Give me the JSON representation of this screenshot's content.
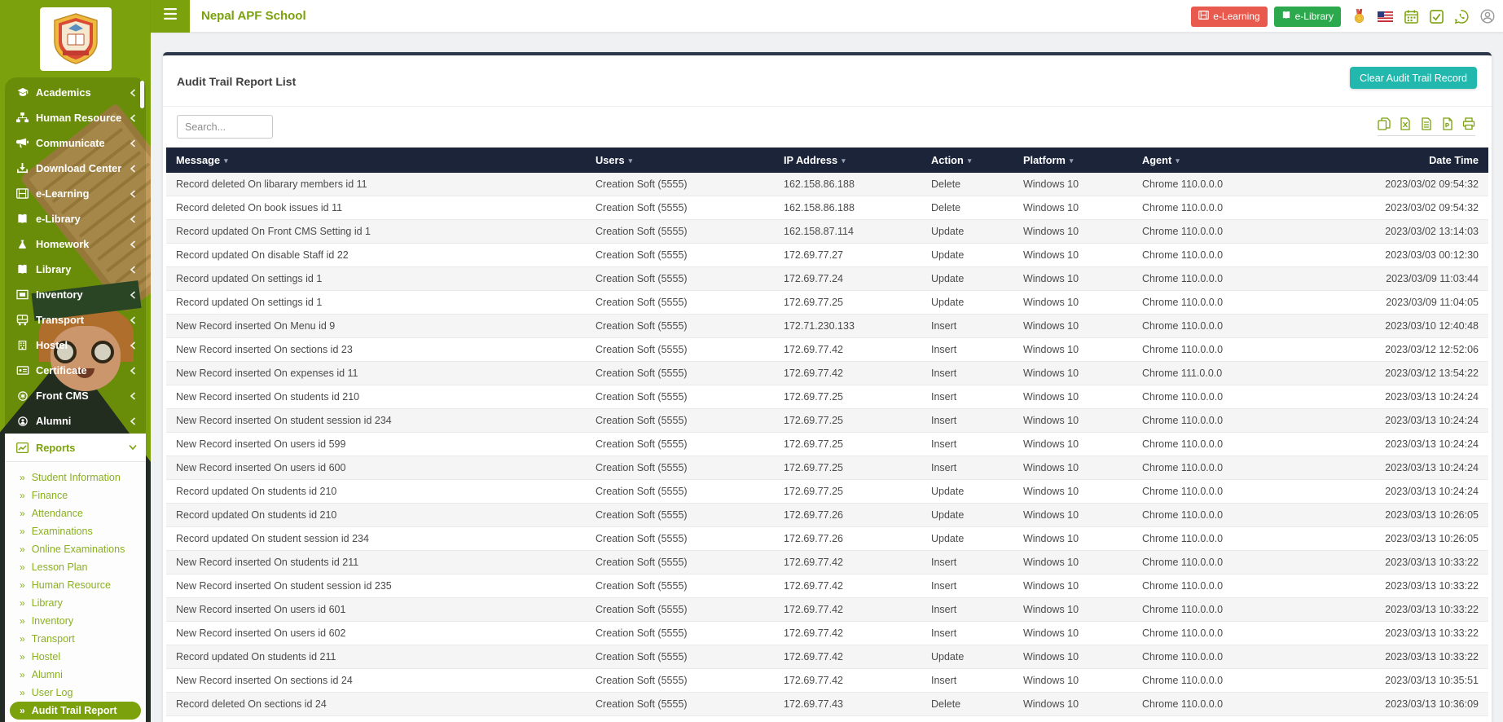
{
  "navbar": {
    "title": "Nepal APF School",
    "elearning_label": "e-Learning",
    "elibrary_label": "e-Library",
    "icons": [
      "medal-icon",
      "us-flag-icon",
      "calendar-icon",
      "approve-leave-icon",
      "whatsapp-icon",
      "profile-icon"
    ]
  },
  "sidebar": {
    "items": [
      {
        "label": "Academics",
        "icon": "graduation-cap-icon"
      },
      {
        "label": "Human Resource",
        "icon": "sitemap-icon"
      },
      {
        "label": "Communicate",
        "icon": "megaphone-icon"
      },
      {
        "label": "Download Center",
        "icon": "download-icon"
      },
      {
        "label": "e-Learning",
        "icon": "film-icon"
      },
      {
        "label": "e-Library",
        "icon": "book-icon"
      },
      {
        "label": "Homework",
        "icon": "flask-icon"
      },
      {
        "label": "Library",
        "icon": "book-icon"
      },
      {
        "label": "Inventory",
        "icon": "inventory-icon"
      },
      {
        "label": "Transport",
        "icon": "bus-icon"
      },
      {
        "label": "Hostel",
        "icon": "building-icon"
      },
      {
        "label": "Certificate",
        "icon": "certificate-icon"
      },
      {
        "label": "Front CMS",
        "icon": "front-cms-icon"
      },
      {
        "label": "Alumni",
        "icon": "alumni-icon"
      }
    ],
    "reports": {
      "label": "Reports",
      "icon": "chart-line-icon"
    },
    "reports_submenu": [
      "Student Information",
      "Finance",
      "Attendance",
      "Examinations",
      "Online Examinations",
      "Lesson Plan",
      "Human Resource",
      "Library",
      "Inventory",
      "Transport",
      "Hostel",
      "Alumni",
      "User Log",
      "Audit Trail Report"
    ],
    "active_item": "Audit Trail Report",
    "submenu_bullet": "»"
  },
  "card": {
    "title": "Audit Trail Report List",
    "clear_button": "Clear Audit Trail Record",
    "search_placeholder": "Search...",
    "export_icons": [
      "copy-icon",
      "excel-icon",
      "csv-icon",
      "pdf-icon",
      "print-icon"
    ]
  },
  "table": {
    "columns": [
      {
        "key": "message",
        "label": "Message",
        "sortable": true
      },
      {
        "key": "users",
        "label": "Users",
        "sortable": true
      },
      {
        "key": "ip",
        "label": "IP Address",
        "sortable": true
      },
      {
        "key": "action",
        "label": "Action",
        "sortable": true
      },
      {
        "key": "platform",
        "label": "Platform",
        "sortable": true
      },
      {
        "key": "agent",
        "label": "Agent",
        "sortable": true
      },
      {
        "key": "datetime",
        "label": "Date Time",
        "sortable": false,
        "align": "right"
      }
    ],
    "sort_glyph": "▾",
    "rows": [
      [
        "Record deleted On libarary members id 11",
        "Creation Soft (5555)",
        "162.158.86.188",
        "Delete",
        "Windows 10",
        "Chrome 110.0.0.0",
        "2023/03/02 09:54:32"
      ],
      [
        "Record deleted On book issues id 11",
        "Creation Soft (5555)",
        "162.158.86.188",
        "Delete",
        "Windows 10",
        "Chrome 110.0.0.0",
        "2023/03/02 09:54:32"
      ],
      [
        "Record updated On Front CMS Setting id 1",
        "Creation Soft (5555)",
        "162.158.87.114",
        "Update",
        "Windows 10",
        "Chrome 110.0.0.0",
        "2023/03/02 13:14:03"
      ],
      [
        "Record updated On disable Staff id 22",
        "Creation Soft (5555)",
        "172.69.77.27",
        "Update",
        "Windows 10",
        "Chrome 110.0.0.0",
        "2023/03/03 00:12:30"
      ],
      [
        "Record updated On settings id 1",
        "Creation Soft (5555)",
        "172.69.77.24",
        "Update",
        "Windows 10",
        "Chrome 110.0.0.0",
        "2023/03/09 11:03:44"
      ],
      [
        "Record updated On settings id 1",
        "Creation Soft (5555)",
        "172.69.77.25",
        "Update",
        "Windows 10",
        "Chrome 110.0.0.0",
        "2023/03/09 11:04:05"
      ],
      [
        "New Record inserted On Menu id 9",
        "Creation Soft (5555)",
        "172.71.230.133",
        "Insert",
        "Windows 10",
        "Chrome 110.0.0.0",
        "2023/03/10 12:40:48"
      ],
      [
        "New Record inserted On sections id 23",
        "Creation Soft (5555)",
        "172.69.77.42",
        "Insert",
        "Windows 10",
        "Chrome 110.0.0.0",
        "2023/03/12 12:52:06"
      ],
      [
        "New Record inserted On expenses id 11",
        "Creation Soft (5555)",
        "172.69.77.42",
        "Insert",
        "Windows 10",
        "Chrome 111.0.0.0",
        "2023/03/12 13:54:22"
      ],
      [
        "New Record inserted On students id 210",
        "Creation Soft (5555)",
        "172.69.77.25",
        "Insert",
        "Windows 10",
        "Chrome 110.0.0.0",
        "2023/03/13 10:24:24"
      ],
      [
        "New Record inserted On student session id 234",
        "Creation Soft (5555)",
        "172.69.77.25",
        "Insert",
        "Windows 10",
        "Chrome 110.0.0.0",
        "2023/03/13 10:24:24"
      ],
      [
        "New Record inserted On users id 599",
        "Creation Soft (5555)",
        "172.69.77.25",
        "Insert",
        "Windows 10",
        "Chrome 110.0.0.0",
        "2023/03/13 10:24:24"
      ],
      [
        "New Record inserted On users id 600",
        "Creation Soft (5555)",
        "172.69.77.25",
        "Insert",
        "Windows 10",
        "Chrome 110.0.0.0",
        "2023/03/13 10:24:24"
      ],
      [
        "Record updated On students id 210",
        "Creation Soft (5555)",
        "172.69.77.25",
        "Update",
        "Windows 10",
        "Chrome 110.0.0.0",
        "2023/03/13 10:24:24"
      ],
      [
        "Record updated On students id 210",
        "Creation Soft (5555)",
        "172.69.77.26",
        "Update",
        "Windows 10",
        "Chrome 110.0.0.0",
        "2023/03/13 10:26:05"
      ],
      [
        "Record updated On student session id 234",
        "Creation Soft (5555)",
        "172.69.77.26",
        "Update",
        "Windows 10",
        "Chrome 110.0.0.0",
        "2023/03/13 10:26:05"
      ],
      [
        "New Record inserted On students id 211",
        "Creation Soft (5555)",
        "172.69.77.42",
        "Insert",
        "Windows 10",
        "Chrome 110.0.0.0",
        "2023/03/13 10:33:22"
      ],
      [
        "New Record inserted On student session id 235",
        "Creation Soft (5555)",
        "172.69.77.42",
        "Insert",
        "Windows 10",
        "Chrome 110.0.0.0",
        "2023/03/13 10:33:22"
      ],
      [
        "New Record inserted On users id 601",
        "Creation Soft (5555)",
        "172.69.77.42",
        "Insert",
        "Windows 10",
        "Chrome 110.0.0.0",
        "2023/03/13 10:33:22"
      ],
      [
        "New Record inserted On users id 602",
        "Creation Soft (5555)",
        "172.69.77.42",
        "Insert",
        "Windows 10",
        "Chrome 110.0.0.0",
        "2023/03/13 10:33:22"
      ],
      [
        "Record updated On students id 211",
        "Creation Soft (5555)",
        "172.69.77.42",
        "Update",
        "Windows 10",
        "Chrome 110.0.0.0",
        "2023/03/13 10:33:22"
      ],
      [
        "New Record inserted On sections id 24",
        "Creation Soft (5555)",
        "172.69.77.42",
        "Insert",
        "Windows 10",
        "Chrome 110.0.0.0",
        "2023/03/13 10:35:51"
      ],
      [
        "Record deleted On sections id 24",
        "Creation Soft (5555)",
        "172.69.77.43",
        "Delete",
        "Windows 10",
        "Chrome 110.0.0.0",
        "2023/03/13 10:36:09"
      ]
    ]
  },
  "colors": {
    "accent_green": "#7ba10c",
    "header_navy": "#1b2439",
    "teal_button": "#23b8ad",
    "elearning_red": "#e95a4e",
    "elibrary_green": "#2ba94c"
  }
}
